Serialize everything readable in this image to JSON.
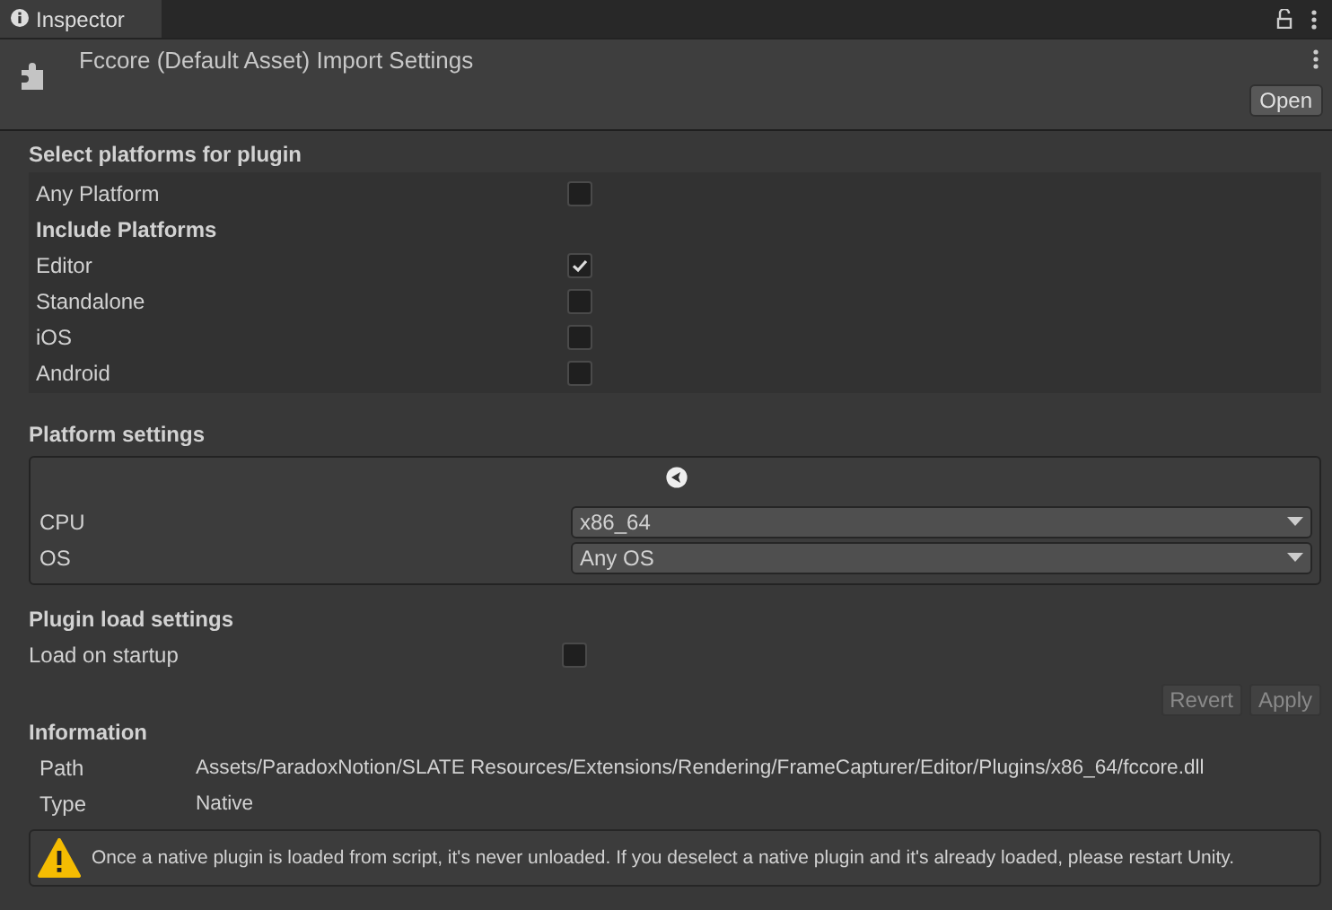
{
  "tab": {
    "label": "Inspector",
    "selected": true
  },
  "header": {
    "title": "Fccore (Default Asset) Import Settings",
    "open_button": "Open"
  },
  "select_platforms": {
    "title": "Select platforms for plugin",
    "rows": [
      {
        "kind": "checkbox",
        "label": "Any Platform",
        "checked": false
      },
      {
        "kind": "heading",
        "label": "Include Platforms"
      },
      {
        "kind": "checkbox",
        "label": "Editor",
        "checked": true
      },
      {
        "kind": "checkbox",
        "label": "Standalone",
        "checked": false
      },
      {
        "kind": "checkbox",
        "label": "iOS",
        "checked": false
      },
      {
        "kind": "checkbox",
        "label": "Android",
        "checked": false
      }
    ]
  },
  "platform_settings": {
    "title": "Platform settings",
    "fields": [
      {
        "label": "CPU",
        "value": "x86_64"
      },
      {
        "label": "OS",
        "value": "Any OS"
      }
    ]
  },
  "plugin_load": {
    "title": "Plugin load settings",
    "label": "Load on startup",
    "checked": false
  },
  "buttons": [
    {
      "label": "Revert",
      "disabled": true
    },
    {
      "label": "Apply",
      "disabled": true
    }
  ],
  "information": {
    "title": "Information",
    "rows": [
      {
        "label": "Path",
        "value": "Assets/ParadoxNotion/SLATE Resources/Extensions/Rendering/FrameCapturer/Editor/Plugins/x86_64/fccore.dll"
      },
      {
        "label": "Type",
        "value": "Native"
      }
    ],
    "warning": "Once a native plugin is loaded from script, it's never unloaded. If you deselect a native plugin and it's already loaded, please restart Unity."
  }
}
